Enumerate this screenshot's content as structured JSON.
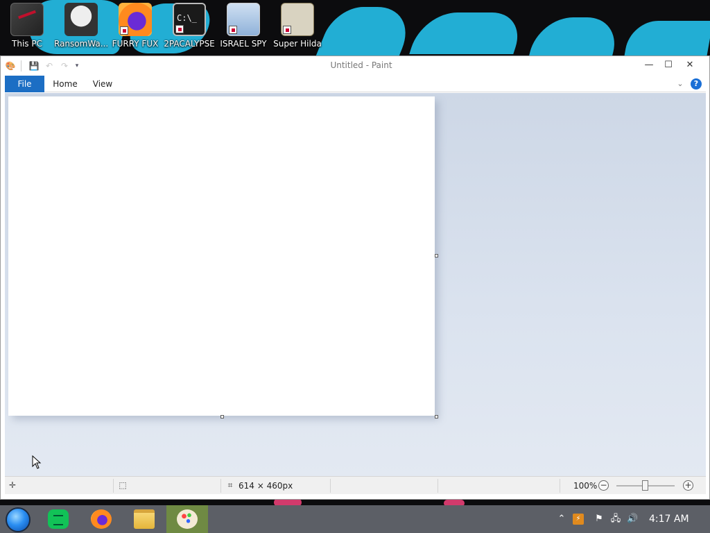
{
  "desktop": {
    "icons": [
      {
        "label": "This PC",
        "icon": "this-pc-icon"
      },
      {
        "label": "RansomWa...",
        "icon": "skull-app-icon"
      },
      {
        "label": "FURRY FUX",
        "icon": "firefox-icon"
      },
      {
        "label": "2PACALYPSE",
        "icon": "cmd-icon"
      },
      {
        "label": "ISRAEL SPY",
        "icon": "network-icon"
      },
      {
        "label": "Super Hilda",
        "icon": "hilda-icon"
      }
    ],
    "colors": {
      "brush": "#22aed4",
      "accent": "#d23a6c"
    }
  },
  "window": {
    "title": "Untitled - Paint",
    "controls": {
      "minimize": "—",
      "maximize": "☐",
      "close": "✕"
    },
    "qat": {
      "app_icon": "paint-app-icon",
      "save": "save-icon",
      "undo": "undo-icon",
      "redo": "redo-icon",
      "customize": "dropdown-icon"
    }
  },
  "ribbon": {
    "tabs": [
      "File",
      "Home",
      "View"
    ],
    "active_color": "#1c6ec4",
    "help": "?"
  },
  "canvas": {
    "background": "#ffffff"
  },
  "status": {
    "image_size": "614 × 460px",
    "zoom": "100%",
    "zoom_level": 1.0
  },
  "taskbar": {
    "apps": [
      {
        "name": "notes",
        "icon": "notes-icon"
      },
      {
        "name": "firefox",
        "icon": "firefox-icon"
      },
      {
        "name": "file-explorer",
        "icon": "folder-icon"
      },
      {
        "name": "paint",
        "icon": "paint-icon",
        "active": true
      }
    ],
    "clock": "4:17 AM"
  }
}
